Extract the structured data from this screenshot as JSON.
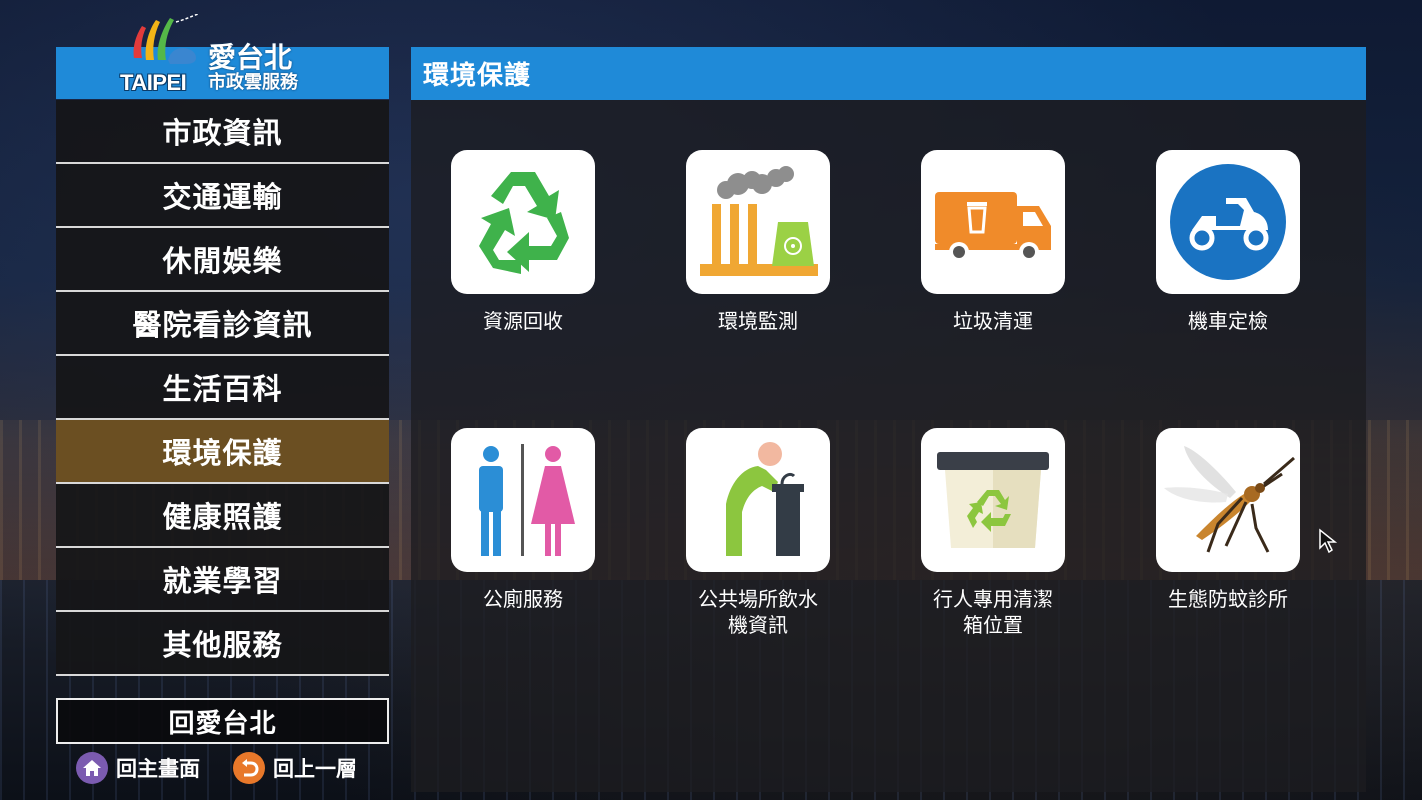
{
  "logo": {
    "brand_en": "TAIPEI",
    "brand_cn_1": "愛台北",
    "brand_cn_2": "市政雲服務"
  },
  "sidebar": {
    "items": [
      {
        "label": "市政資訊",
        "active": false
      },
      {
        "label": "交通運輸",
        "active": false
      },
      {
        "label": "休閒娛樂",
        "active": false
      },
      {
        "label": "醫院看診資訊",
        "active": false
      },
      {
        "label": "生活百科",
        "active": false
      },
      {
        "label": "環境保護",
        "active": true
      },
      {
        "label": "健康照護",
        "active": false
      },
      {
        "label": "就業學習",
        "active": false
      },
      {
        "label": "其他服務",
        "active": false
      }
    ],
    "back_button": "回愛台北",
    "home_hint": "回主畫面",
    "back_hint": "回上一層"
  },
  "main": {
    "title": "環境保護",
    "tiles": [
      {
        "label": "資源回收",
        "icon": "recycle-icon"
      },
      {
        "label": "環境監測",
        "icon": "factory-icon"
      },
      {
        "label": "垃圾清運",
        "icon": "garbage-truck-icon"
      },
      {
        "label": "機車定檢",
        "icon": "scooter-icon"
      },
      {
        "label": "公廁服務",
        "icon": "restroom-icon"
      },
      {
        "label": "公共場所飲水機資訊",
        "line1": "公共場所飲水",
        "line2": "機資訊",
        "icon": "water-fountain-icon"
      },
      {
        "label": "行人專用清潔箱位置",
        "line1": "行人專用清潔",
        "line2": "箱位置",
        "icon": "trash-bin-icon"
      },
      {
        "label": "生態防蚊診所",
        "icon": "mosquito-icon"
      }
    ]
  },
  "colors": {
    "header_blue": "#1f8ad8",
    "active_item": "#6b4f22",
    "home_badge": "#7b5bb0",
    "back_badge": "#e8782a"
  }
}
